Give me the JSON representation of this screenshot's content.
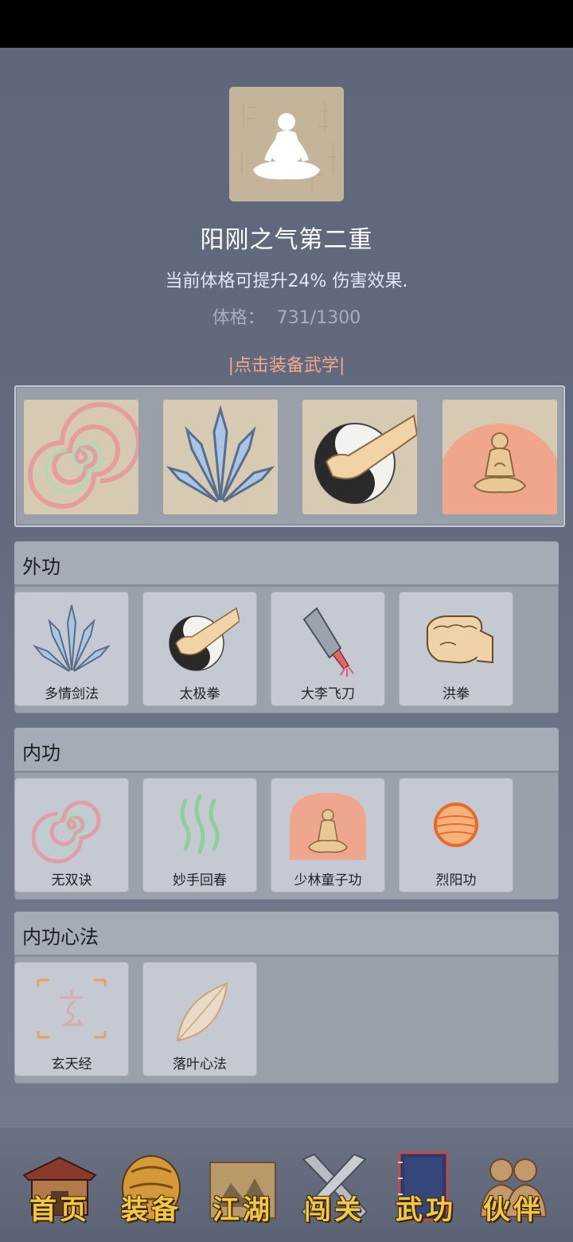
{
  "realm": {
    "title": "阳刚之气第二重",
    "description": "当前体格可提升24% 伤害效果.",
    "physique_label": "体格：",
    "physique_value": "731/1300"
  },
  "equip_hint": "|点击装备武学|",
  "equipped_icons": [
    "spiral-icon",
    "sword-fan-icon",
    "taiji-fist-icon",
    "meditation-icon"
  ],
  "sections": [
    {
      "title": "外功",
      "skills": [
        {
          "name": "多情剑法",
          "icon": "sword-fan-icon"
        },
        {
          "name": "太极拳",
          "icon": "taiji-fist-icon"
        },
        {
          "name": "大李飞刀",
          "icon": "cleaver-icon"
        },
        {
          "name": "洪拳",
          "icon": "fist-icon"
        }
      ]
    },
    {
      "title": "内功",
      "skills": [
        {
          "name": "无双诀",
          "icon": "spiral-icon"
        },
        {
          "name": "妙手回春",
          "icon": "green-waves-icon"
        },
        {
          "name": "少林童子功",
          "icon": "meditation-icon"
        },
        {
          "name": "烈阳功",
          "icon": "sun-orb-icon"
        }
      ]
    },
    {
      "title": "内功心法",
      "skills": [
        {
          "name": "玄天经",
          "icon": "xuan-scroll-icon"
        },
        {
          "name": "落叶心法",
          "icon": "leaf-icon"
        }
      ]
    }
  ],
  "nav": [
    {
      "label": "首页",
      "icon": "house-icon"
    },
    {
      "label": "装备",
      "icon": "armor-icon"
    },
    {
      "label": "江湖",
      "icon": "scroll-map-icon"
    },
    {
      "label": "闯关",
      "icon": "crossed-swords-icon"
    },
    {
      "label": "武功",
      "icon": "book-icon"
    },
    {
      "label": "伙伴",
      "icon": "partners-icon"
    }
  ],
  "colors": {
    "background": "#5d6679",
    "hint": "#f2a78e",
    "nav_text": "#f5c842",
    "portrait": "#c4b49a"
  }
}
